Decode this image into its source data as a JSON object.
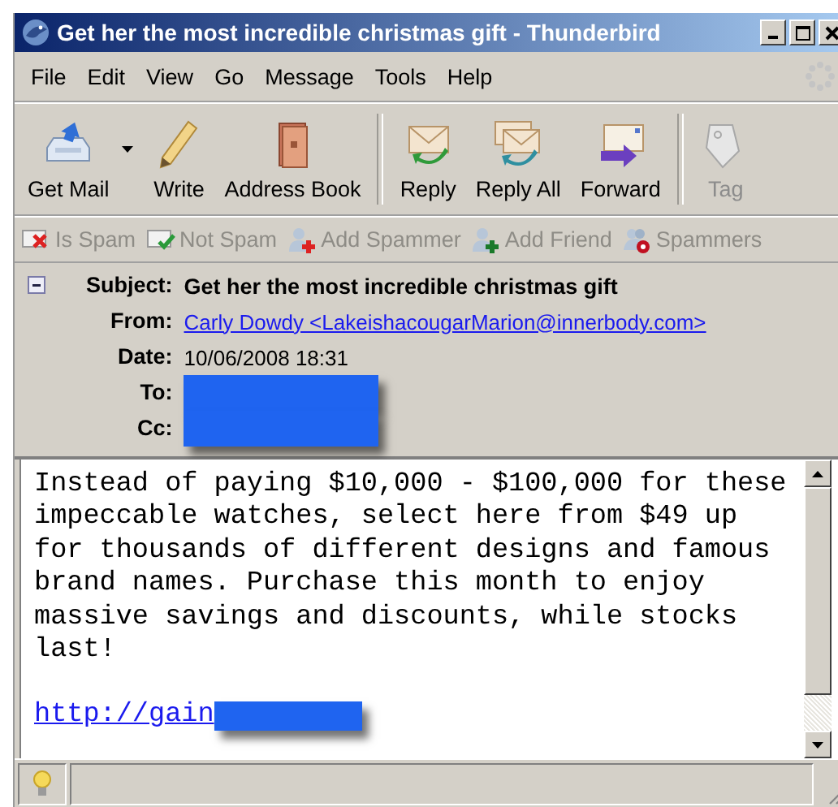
{
  "window": {
    "title": "Get her the most incredible christmas gift - Thunderbird"
  },
  "menu": [
    "File",
    "Edit",
    "View",
    "Go",
    "Message",
    "Tools",
    "Help"
  ],
  "toolbar": [
    {
      "label": "Get Mail",
      "kind": "getmail",
      "disabled": false
    },
    {
      "label": "Write",
      "kind": "write",
      "disabled": false
    },
    {
      "label": "Address Book",
      "kind": "book",
      "disabled": false
    },
    {
      "kind": "separator"
    },
    {
      "label": "Reply",
      "kind": "reply",
      "disabled": false
    },
    {
      "label": "Reply All",
      "kind": "replyall",
      "disabled": false
    },
    {
      "label": "Forward",
      "kind": "forward",
      "disabled": false
    },
    {
      "kind": "separator"
    },
    {
      "label": "Tag",
      "kind": "tag",
      "disabled": true
    }
  ],
  "spam_bar": [
    {
      "label": "Is Spam",
      "kind": "isspam",
      "disabled": true
    },
    {
      "label": "Not Spam",
      "kind": "notspam",
      "disabled": true
    },
    {
      "label": "Add Spammer",
      "kind": "addspammer",
      "disabled": true
    },
    {
      "label": "Add Friend",
      "kind": "addfriend",
      "disabled": true
    },
    {
      "label": "Spammers",
      "kind": "spammers",
      "disabled": true
    }
  ],
  "header": {
    "expanded": true,
    "fields": [
      {
        "label": "Subject:",
        "kind": "subject",
        "value": "Get her the most incredible christmas gift"
      },
      {
        "label": "From:",
        "kind": "link",
        "value": "Carly Dowdy <LakeishacougarMarion@innerbody.com>"
      },
      {
        "label": "Date:",
        "kind": "text",
        "value": "10/06/2008 18:31"
      },
      {
        "label": "To:",
        "kind": "redacted"
      },
      {
        "label": "Cc:",
        "kind": "redacted"
      }
    ]
  },
  "body": {
    "text": "Instead of paying $10,000 - $100,000 for these impeccable watches, select here from $49 up for thousands of different designs and famous brand names. Purchase this month to enjoy massive savings and discounts, while stocks last!",
    "link": "http://gain",
    "link_redacted": true
  }
}
